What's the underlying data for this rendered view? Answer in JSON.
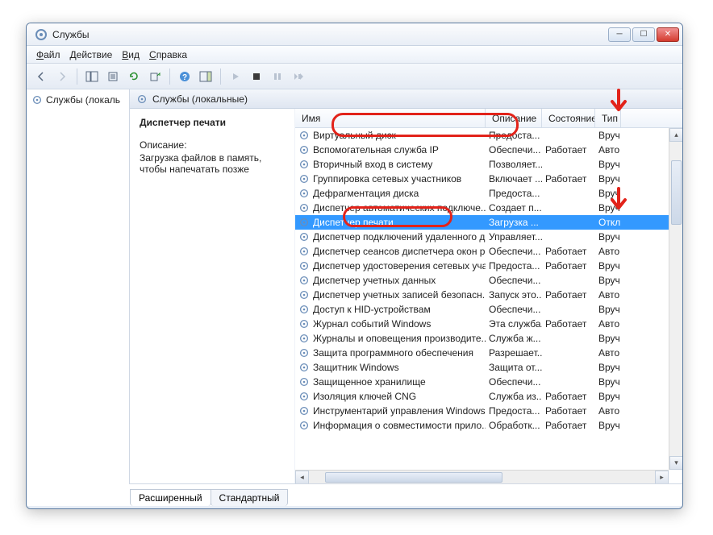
{
  "window": {
    "title": "Службы"
  },
  "menubar": {
    "file": "Файл",
    "action": "Действие",
    "view": "Вид",
    "help": "Справка"
  },
  "left_pane": {
    "root": "Службы (локаль"
  },
  "pane": {
    "header": "Службы (локальные)"
  },
  "detail": {
    "title": "Диспетчер печати",
    "desc_label": "Описание:",
    "desc_text": "Загрузка файлов в память, чтобы напечатать позже"
  },
  "columns": {
    "name": "Имя",
    "desc": "Описание",
    "state": "Состояние",
    "type": "Тип"
  },
  "services": [
    {
      "name": "Виртуальный диск",
      "desc": "Предоста...",
      "state": "",
      "type": "Вруч"
    },
    {
      "name": "Вспомогательная служба IP",
      "desc": "Обеспечи...",
      "state": "Работает",
      "type": "Авто"
    },
    {
      "name": "Вторичный вход в систему",
      "desc": "Позволяет...",
      "state": "",
      "type": "Вруч"
    },
    {
      "name": "Группировка сетевых участников",
      "desc": "Включает ...",
      "state": "Работает",
      "type": "Вруч"
    },
    {
      "name": "Дефрагментация диска",
      "desc": "Предоста...",
      "state": "",
      "type": "Вруч"
    },
    {
      "name": "Диспетчер автоматических подключе...",
      "desc": "Создает п...",
      "state": "",
      "type": "Вруч"
    },
    {
      "name": "Диспетчер печати",
      "desc": "Загрузка ...",
      "state": "",
      "type": "Откл",
      "selected": true
    },
    {
      "name": "Диспетчер подключений удаленного д...",
      "desc": "Управляет...",
      "state": "",
      "type": "Вруч"
    },
    {
      "name": "Диспетчер сеансов диспетчера окон р...",
      "desc": "Обеспечи...",
      "state": "Работает",
      "type": "Авто"
    },
    {
      "name": "Диспетчер удостоверения сетевых уча...",
      "desc": "Предоста...",
      "state": "Работает",
      "type": "Вруч"
    },
    {
      "name": "Диспетчер учетных данных",
      "desc": "Обеспечи...",
      "state": "",
      "type": "Вруч"
    },
    {
      "name": "Диспетчер учетных записей безопасн...",
      "desc": "Запуск это...",
      "state": "Работает",
      "type": "Авто"
    },
    {
      "name": "Доступ к HID-устройствам",
      "desc": "Обеспечи...",
      "state": "",
      "type": "Вруч"
    },
    {
      "name": "Журнал событий Windows",
      "desc": "Эта служба...",
      "state": "Работает",
      "type": "Авто"
    },
    {
      "name": "Журналы и оповещения производите...",
      "desc": "Служба ж...",
      "state": "",
      "type": "Вруч"
    },
    {
      "name": "Защита программного обеспечения",
      "desc": "Разрешает...",
      "state": "",
      "type": "Авто"
    },
    {
      "name": "Защитник Windows",
      "desc": "Защита от...",
      "state": "",
      "type": "Вруч"
    },
    {
      "name": "Защищенное хранилище",
      "desc": "Обеспечи...",
      "state": "",
      "type": "Вруч"
    },
    {
      "name": "Изоляция ключей CNG",
      "desc": "Служба из...",
      "state": "Работает",
      "type": "Вруч"
    },
    {
      "name": "Инструментарий управления Windows",
      "desc": "Предоста...",
      "state": "Работает",
      "type": "Авто"
    },
    {
      "name": "Информация о совместимости прило...",
      "desc": "Обработк...",
      "state": "Работает",
      "type": "Вруч"
    }
  ],
  "tabs": {
    "extended": "Расширенный",
    "standard": "Стандартный"
  }
}
